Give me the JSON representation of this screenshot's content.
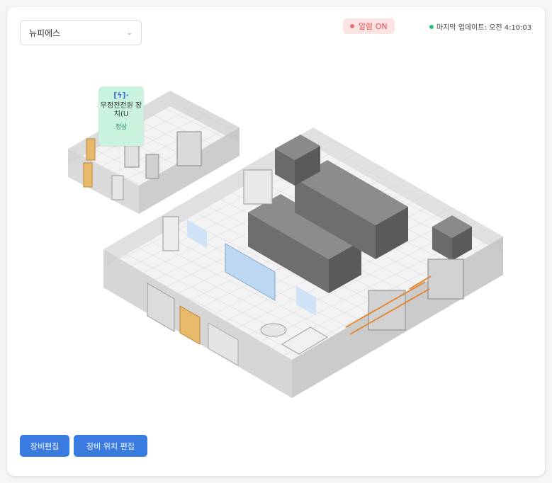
{
  "site_select": {
    "value": "뉴피에스"
  },
  "alarm": {
    "label": "알람 ON"
  },
  "last_update": {
    "text": "마지막 업데이트: 오전 4:10:03"
  },
  "ups_tooltip": {
    "icon_text": "[ϟ]·",
    "name": "무정전전원 장치(U",
    "status": "정상"
  },
  "buttons": {
    "edit_equipment": "장비편집",
    "edit_location": "장비 위치 편집"
  },
  "colors": {
    "primary": "#3a7be0",
    "alarm_bg": "#fde4e4",
    "alarm_text": "#e05050",
    "ok": "#2ec27e",
    "tooltip_bg": "#c9f2df"
  }
}
